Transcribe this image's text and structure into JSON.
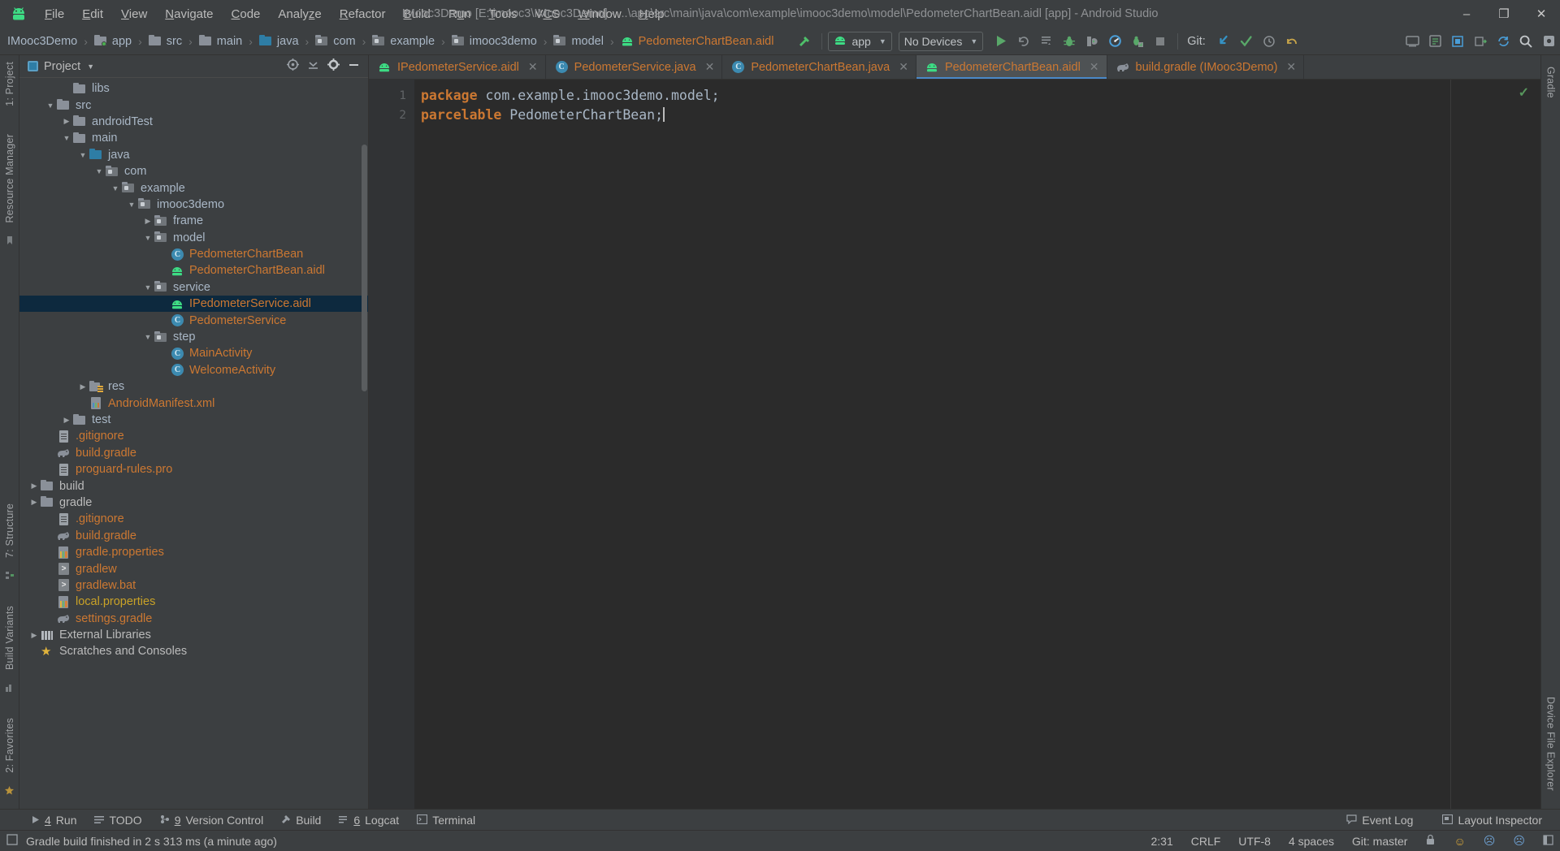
{
  "window": {
    "title": "IMooc3Demo [E:\\imooc3\\IMooc3Demo] - ...\\app\\src\\main\\java\\com\\example\\imooc3demo\\model\\PedometerChartBean.aidl [app] - Android Studio",
    "minimize": "–",
    "maximize": "❐",
    "close": "✕"
  },
  "menubar": {
    "items": [
      {
        "label": "File"
      },
      {
        "label": "Edit"
      },
      {
        "label": "View"
      },
      {
        "label": "Navigate"
      },
      {
        "label": "Code"
      },
      {
        "label": "Analyze"
      },
      {
        "label": "Refactor"
      },
      {
        "label": "Build"
      },
      {
        "label": "Run"
      },
      {
        "label": "Tools"
      },
      {
        "label": "VCS"
      },
      {
        "label": "Window"
      },
      {
        "label": "Help"
      }
    ]
  },
  "toolbar": {
    "breadcrumbs": [
      {
        "label": "IMooc3Demo",
        "icon": "none",
        "kind": "project"
      },
      {
        "label": "app",
        "icon": "folder-app-icon",
        "kind": "module"
      },
      {
        "label": "src",
        "icon": "folder-icon",
        "kind": "folder"
      },
      {
        "label": "main",
        "icon": "folder-icon",
        "kind": "folder"
      },
      {
        "label": "java",
        "icon": "folder-source-icon",
        "kind": "source"
      },
      {
        "label": "com",
        "icon": "folder-package-icon",
        "kind": "package"
      },
      {
        "label": "example",
        "icon": "folder-package-icon",
        "kind": "package"
      },
      {
        "label": "imooc3demo",
        "icon": "folder-package-icon",
        "kind": "package"
      },
      {
        "label": "model",
        "icon": "folder-package-icon",
        "kind": "package"
      },
      {
        "label": "PedometerChartBean.aidl",
        "icon": "aidl-icon",
        "kind": "file"
      }
    ],
    "separator": "›",
    "build_hammer_icon": "hammer-icon",
    "run_config": {
      "label": "app",
      "icon": "android-icon",
      "arrow": "▼"
    },
    "device_select": {
      "label": "No Devices",
      "arrow": "▼"
    },
    "actions": [
      {
        "name": "run-button",
        "icon": "play-icon"
      },
      {
        "name": "rerun-button",
        "icon": "rerun-icon"
      },
      {
        "name": "apply-changes-button",
        "icon": "apply-changes-icon"
      },
      {
        "name": "debug-button",
        "icon": "bug-icon"
      },
      {
        "name": "attach-debugger-button",
        "icon": "attach-debug-icon"
      },
      {
        "name": "profiler-button",
        "icon": "profiler-icon"
      },
      {
        "name": "run-with-coverage-button",
        "icon": "coverage-icon"
      },
      {
        "name": "stop-button",
        "icon": "stop-icon"
      }
    ],
    "git_label": "Git:",
    "git_actions": [
      {
        "name": "update-project-button",
        "icon": "down-arrow-icon"
      },
      {
        "name": "commit-button",
        "icon": "check-icon"
      },
      {
        "name": "history-button",
        "icon": "clock-icon"
      },
      {
        "name": "revert-button",
        "icon": "undo-icon"
      }
    ],
    "right_actions": [
      {
        "name": "avd-manager-button",
        "icon": "avd-icon"
      },
      {
        "name": "sdk-manager-button",
        "icon": "sdk-icon"
      },
      {
        "name": "layout-inspector-button",
        "icon": "layout-icon"
      },
      {
        "name": "attach-debugger-to-process-button",
        "icon": "process-icon"
      },
      {
        "name": "sync-gradle-button",
        "icon": "sync-icon"
      },
      {
        "name": "search-everywhere-button",
        "icon": "search-icon"
      },
      {
        "name": "settings-button",
        "icon": "gear-icon"
      }
    ]
  },
  "left_rail": {
    "top": [
      {
        "label": "1: Project"
      }
    ],
    "middle": [
      {
        "label": "Resource Manager"
      }
    ],
    "bottom": [
      {
        "label": "7: Structure"
      },
      {
        "label": "Build Variants"
      },
      {
        "label": "2: Favorites"
      }
    ]
  },
  "right_rail": {
    "items": [
      {
        "label": "Gradle"
      },
      {
        "label": "Device File Explorer"
      }
    ]
  },
  "project_panel": {
    "title": "Project",
    "caret": "▼",
    "actions": [
      {
        "name": "select-opened-file-icon",
        "icon": "crosshair-icon"
      },
      {
        "name": "collapse-all-icon",
        "icon": "collapse-icon"
      },
      {
        "name": "settings-icon",
        "icon": "gear-icon"
      },
      {
        "name": "hide-panel-icon",
        "icon": "minus-icon"
      }
    ],
    "tree": [
      {
        "label": "libs",
        "indent": 3,
        "arrow": "",
        "icon": "folder-icon",
        "color": "default",
        "selected": false
      },
      {
        "label": "src",
        "indent": 2,
        "arrow": "▼",
        "icon": "folder-icon",
        "color": "default",
        "selected": false
      },
      {
        "label": "androidTest",
        "indent": 3,
        "arrow": "▶",
        "icon": "folder-icon",
        "color": "default",
        "selected": false
      },
      {
        "label": "main",
        "indent": 3,
        "arrow": "▼",
        "icon": "folder-icon",
        "color": "default",
        "selected": false
      },
      {
        "label": "java",
        "indent": 4,
        "arrow": "▼",
        "icon": "folder-source-icon",
        "color": "default",
        "selected": false
      },
      {
        "label": "com",
        "indent": 5,
        "arrow": "▼",
        "icon": "folder-package-icon",
        "color": "default",
        "selected": false
      },
      {
        "label": "example",
        "indent": 6,
        "arrow": "▼",
        "icon": "folder-package-icon",
        "color": "default",
        "selected": false
      },
      {
        "label": "imooc3demo",
        "indent": 7,
        "arrow": "▼",
        "icon": "folder-package-icon",
        "color": "default",
        "selected": false
      },
      {
        "label": "frame",
        "indent": 8,
        "arrow": "▶",
        "icon": "folder-package-icon",
        "color": "default",
        "selected": false
      },
      {
        "label": "model",
        "indent": 8,
        "arrow": "▼",
        "icon": "folder-package-icon",
        "color": "default",
        "selected": false
      },
      {
        "label": "PedometerChartBean",
        "indent": 9,
        "arrow": "",
        "icon": "class-icon",
        "color": "file",
        "selected": false
      },
      {
        "label": "PedometerChartBean.aidl",
        "indent": 9,
        "arrow": "",
        "icon": "aidl-icon",
        "color": "file",
        "selected": false
      },
      {
        "label": "service",
        "indent": 8,
        "arrow": "▼",
        "icon": "folder-package-icon",
        "color": "default",
        "selected": false
      },
      {
        "label": "IPedometerService.aidl",
        "indent": 9,
        "arrow": "",
        "icon": "aidl-icon",
        "color": "file",
        "selected": true
      },
      {
        "label": "PedometerService",
        "indent": 9,
        "arrow": "",
        "icon": "class-icon",
        "color": "file",
        "selected": false
      },
      {
        "label": "step",
        "indent": 8,
        "arrow": "▼",
        "icon": "folder-package-icon",
        "color": "default",
        "selected": false
      },
      {
        "label": "MainActivity",
        "indent": 9,
        "arrow": "",
        "icon": "class-icon",
        "color": "file",
        "selected": false
      },
      {
        "label": "WelcomeActivity",
        "indent": 9,
        "arrow": "",
        "icon": "class-icon",
        "color": "file",
        "selected": false
      },
      {
        "label": "res",
        "indent": 4,
        "arrow": "▶",
        "icon": "res-folder-icon",
        "color": "default",
        "selected": false
      },
      {
        "label": "AndroidManifest.xml",
        "indent": 4,
        "arrow": "",
        "icon": "xml-icon",
        "color": "file",
        "selected": false
      },
      {
        "label": "test",
        "indent": 3,
        "arrow": "▶",
        "icon": "folder-icon",
        "color": "default",
        "selected": false
      },
      {
        "label": ".gitignore",
        "indent": 2,
        "arrow": "",
        "icon": "doc-icon",
        "color": "file",
        "selected": false
      },
      {
        "label": "build.gradle",
        "indent": 2,
        "arrow": "",
        "icon": "gradle-icon",
        "color": "file",
        "selected": false
      },
      {
        "label": "proguard-rules.pro",
        "indent": 2,
        "arrow": "",
        "icon": "doc-icon",
        "color": "file",
        "selected": false
      },
      {
        "label": "build",
        "indent": 1,
        "arrow": "▶",
        "icon": "folder-icon",
        "color": "white",
        "selected": false
      },
      {
        "label": "gradle",
        "indent": 1,
        "arrow": "▶",
        "icon": "folder-icon",
        "color": "white",
        "selected": false
      },
      {
        "label": ".gitignore",
        "indent": 2,
        "arrow": "",
        "icon": "doc-icon",
        "color": "file",
        "selected": false
      },
      {
        "label": "build.gradle",
        "indent": 2,
        "arrow": "",
        "icon": "gradle-icon",
        "color": "file",
        "selected": false
      },
      {
        "label": "gradle.properties",
        "indent": 2,
        "arrow": "",
        "icon": "props-icon",
        "color": "file",
        "selected": false
      },
      {
        "label": "gradlew",
        "indent": 2,
        "arrow": "",
        "icon": "script-icon",
        "color": "file",
        "selected": false
      },
      {
        "label": "gradlew.bat",
        "indent": 2,
        "arrow": "",
        "icon": "script-icon",
        "color": "file",
        "selected": false
      },
      {
        "label": "local.properties",
        "indent": 2,
        "arrow": "",
        "icon": "props-icon",
        "color": "yellow",
        "selected": false
      },
      {
        "label": "settings.gradle",
        "indent": 2,
        "arrow": "",
        "icon": "gradle-icon",
        "color": "file",
        "selected": false
      },
      {
        "label": "External Libraries",
        "indent": 1,
        "arrow": "▶",
        "icon": "libs-icon",
        "color": "white",
        "selected": false
      },
      {
        "label": "Scratches and Consoles",
        "indent": 1,
        "arrow": "",
        "icon": "scratch-icon",
        "color": "white",
        "selected": false
      }
    ]
  },
  "editor": {
    "tabs": [
      {
        "label": "IPedometerService.aidl",
        "icon": "aidl-icon",
        "active": false,
        "close": "✕"
      },
      {
        "label": "PedometerService.java",
        "icon": "class-icon",
        "active": false,
        "close": "✕"
      },
      {
        "label": "PedometerChartBean.java",
        "icon": "class-icon",
        "active": false,
        "close": "✕"
      },
      {
        "label": "PedometerChartBean.aidl",
        "icon": "aidl-icon",
        "active": true,
        "close": "✕"
      },
      {
        "label": "build.gradle (IMooc3Demo)",
        "icon": "gradle-icon",
        "active": false,
        "close": "✕"
      }
    ],
    "gutter": [
      "1",
      "2"
    ],
    "lines": [
      {
        "tokens": [
          {
            "t": "package",
            "c": "kw"
          },
          {
            "t": " com.example.imooc3demo.model;",
            "c": "pl"
          }
        ]
      },
      {
        "tokens": [
          {
            "t": "parcelable",
            "c": "kw"
          },
          {
            "t": " PedometerChartBean;",
            "c": "pl"
          }
        ]
      }
    ],
    "inspection_ok": "✓"
  },
  "bottom_bar": {
    "items": [
      {
        "num": "4",
        "label": "Run",
        "icon": "play-icon"
      },
      {
        "num": "",
        "label": "TODO",
        "icon": "list-icon"
      },
      {
        "num": "9",
        "label": "Version Control",
        "icon": "vcs-icon"
      },
      {
        "num": "",
        "label": "Build",
        "icon": "hammer-icon"
      },
      {
        "num": "6",
        "label": "Logcat",
        "icon": "logcat-icon"
      },
      {
        "num": "",
        "label": "Terminal",
        "icon": "terminal-icon"
      }
    ],
    "right": [
      {
        "label": "Event Log",
        "icon": "event-log-icon"
      },
      {
        "label": "Layout Inspector",
        "icon": "layout-inspector-icon"
      }
    ]
  },
  "status_bar": {
    "message": "Gradle build finished in 2 s 313 ms (a minute ago)",
    "caret_position": "2:31",
    "line_separator": "CRLF",
    "encoding": "UTF-8",
    "indent": "4 spaces",
    "git_branch": "Git: master",
    "lock_icon": "lock-icon",
    "faces": [
      "☺",
      "☹",
      "☹"
    ],
    "hide_icon": "hide-icon"
  }
}
